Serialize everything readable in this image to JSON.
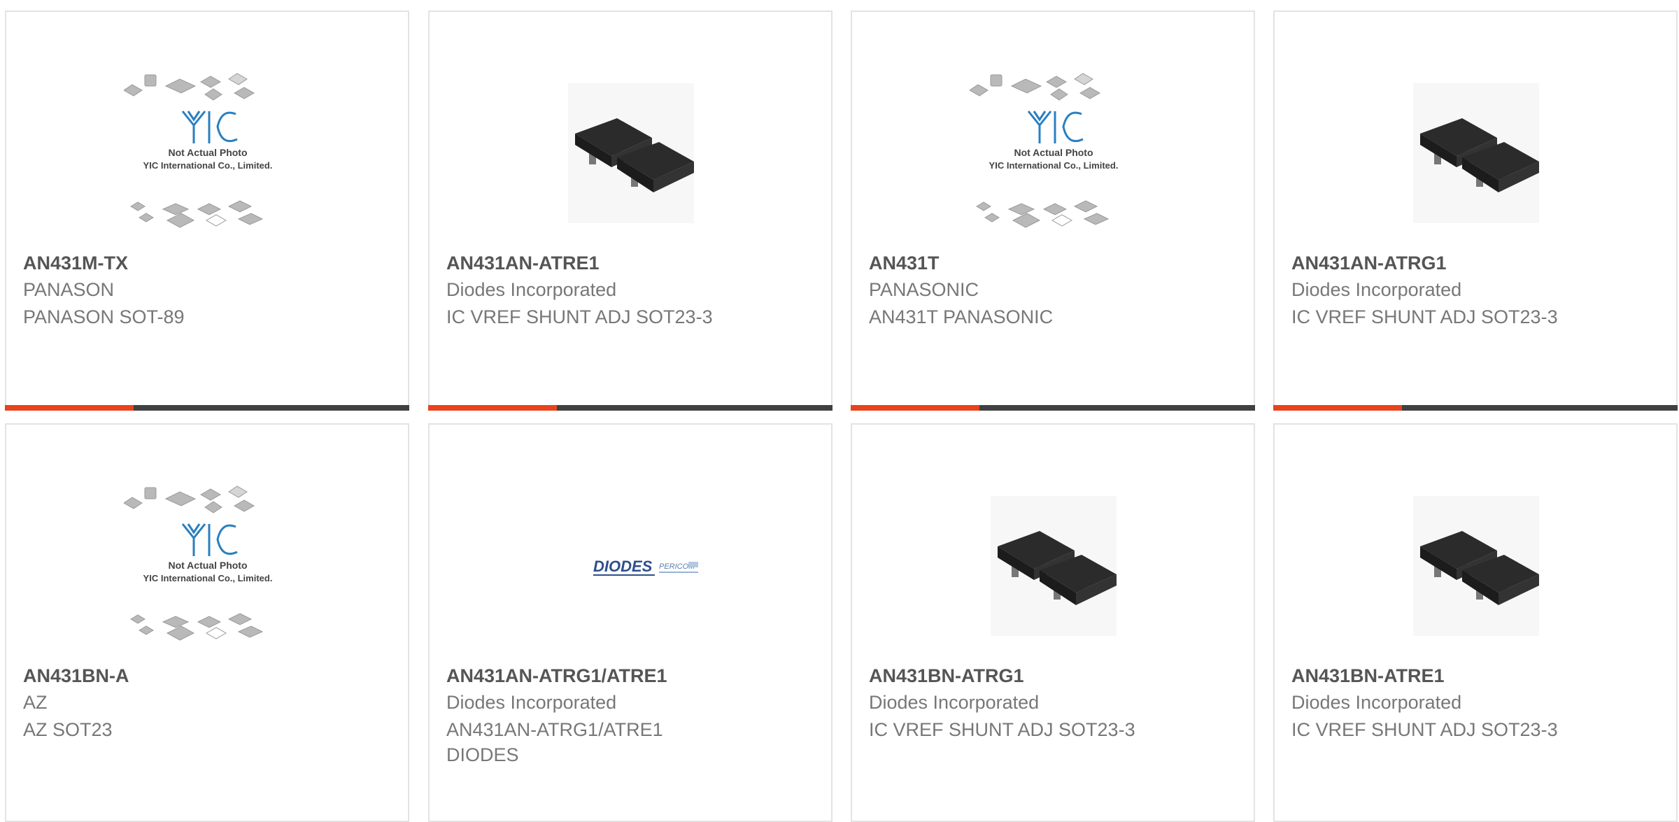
{
  "colors": {
    "accent": "#e8431c",
    "bar": "#404040",
    "border": "#e3e3e3",
    "title": "#555555",
    "text": "#777777"
  },
  "placeholder": {
    "line1": "Not Actual Photo",
    "line2": "YIC International Co., Limited.",
    "logo": "YIC"
  },
  "diodes_logo": {
    "brand": "DIODES",
    "brand2": "PERICOM"
  },
  "products": [
    {
      "part": "AN431M-TX",
      "manufacturer": "PANASON",
      "description": "PANASON SOT-89",
      "image": "yic-placeholder"
    },
    {
      "part": "AN431AN-ATRE1",
      "manufacturer": "Diodes Incorporated",
      "description": "IC VREF SHUNT ADJ SOT23-3",
      "image": "sot23-package"
    },
    {
      "part": "AN431T",
      "manufacturer": "PANASONIC",
      "description": "AN431T PANASONIC",
      "image": "yic-placeholder"
    },
    {
      "part": "AN431AN-ATRG1",
      "manufacturer": "Diodes Incorporated",
      "description": "IC VREF SHUNT ADJ SOT23-3",
      "image": "sot23-package"
    },
    {
      "part": "AN431BN-A",
      "manufacturer": "AZ",
      "description": "AZ SOT23",
      "image": "yic-placeholder"
    },
    {
      "part": "AN431AN-ATRG1/ATRE1",
      "manufacturer": "Diodes Incorporated",
      "description": "AN431AN-ATRG1/ATRE1 DIODES",
      "image": "diodes-logo"
    },
    {
      "part": "AN431BN-ATRG1",
      "manufacturer": "Diodes Incorporated",
      "description": "IC VREF SHUNT ADJ SOT23-3",
      "image": "sot23-package"
    },
    {
      "part": "AN431BN-ATRE1",
      "manufacturer": "Diodes Incorporated",
      "description": "IC VREF SHUNT ADJ SOT23-3",
      "image": "sot23-package"
    }
  ]
}
